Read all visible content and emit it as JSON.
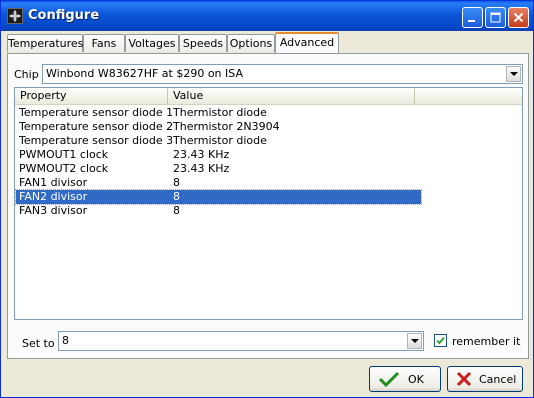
{
  "window": {
    "title": "Configure"
  },
  "tabs": [
    {
      "label": "Temperatures"
    },
    {
      "label": "Fans"
    },
    {
      "label": "Voltages"
    },
    {
      "label": "Speeds"
    },
    {
      "label": "Options"
    },
    {
      "label": "Advanced"
    }
  ],
  "active_tab": "Advanced",
  "chip": {
    "label": "Chip",
    "value": "Winbond W83627HF at $290 on ISA"
  },
  "table": {
    "columns": [
      "Property",
      "Value"
    ],
    "rows": [
      {
        "property": "Temperature sensor diode 1",
        "value": "Thermistor diode"
      },
      {
        "property": "Temperature sensor diode 2",
        "value": "Thermistor 2N3904"
      },
      {
        "property": "Temperature sensor diode 3",
        "value": "Thermistor diode"
      },
      {
        "property": "PWMOUT1 clock",
        "value": "23.43 KHz"
      },
      {
        "property": "PWMOUT2 clock",
        "value": "23.43 KHz"
      },
      {
        "property": "FAN1 divisor",
        "value": "8"
      },
      {
        "property": "FAN2 divisor",
        "value": "8"
      },
      {
        "property": "FAN3 divisor",
        "value": "8"
      }
    ],
    "selected_row": 6
  },
  "set_to": {
    "label": "Set to",
    "value": "8"
  },
  "remember": {
    "label": "remember it",
    "checked": true
  },
  "buttons": {
    "ok": "OK",
    "cancel": "Cancel"
  },
  "colors": {
    "selection": "#316ac5",
    "titlebar": "#0a56d8",
    "active_tab_accent": "#e68b2c"
  },
  "icons": {
    "ok": "checkmark-icon",
    "cancel": "x-icon",
    "app": "fan-icon"
  }
}
